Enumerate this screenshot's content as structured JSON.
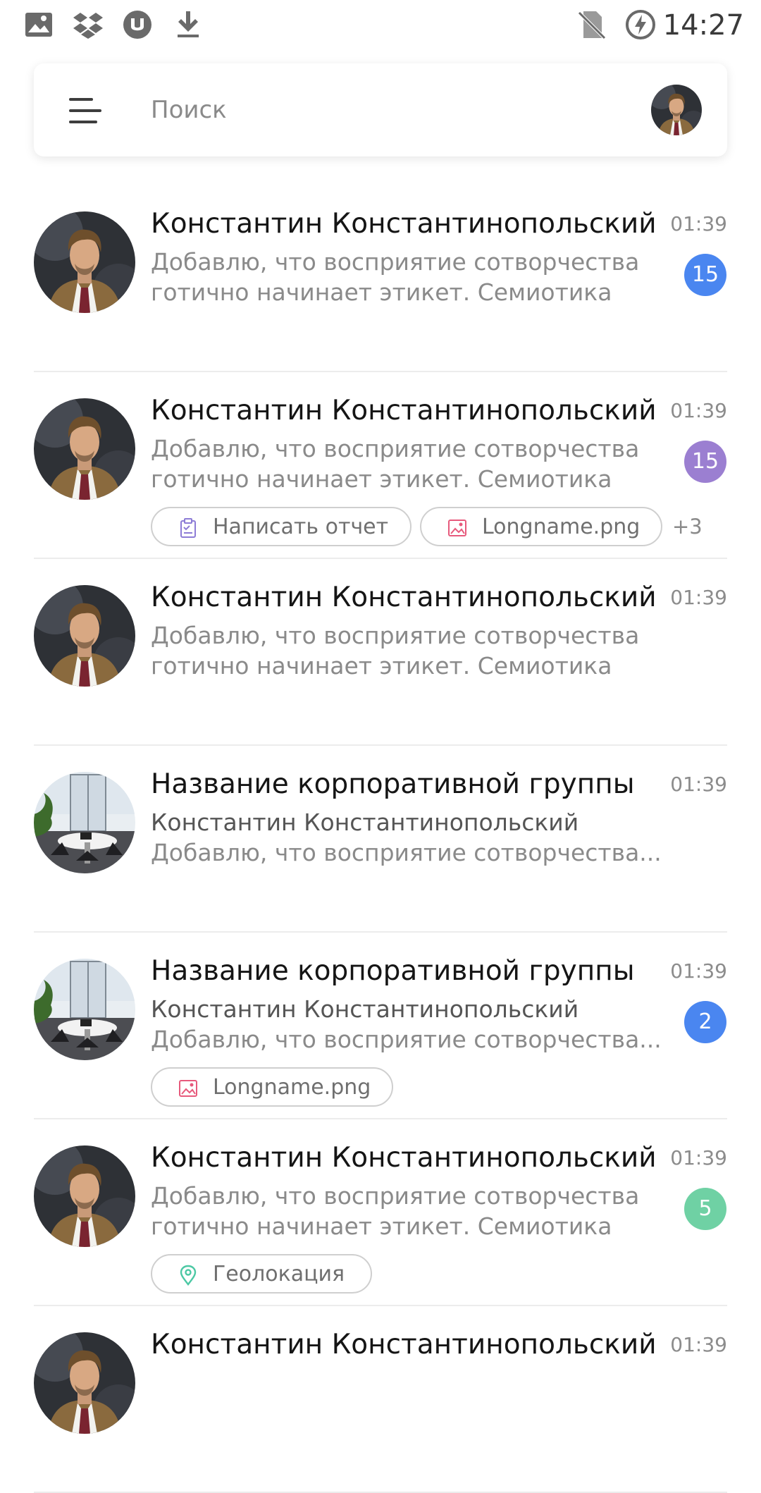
{
  "status_bar": {
    "time": "14:27",
    "left_icons": [
      "gallery-icon",
      "dropbox-icon",
      "torrent-icon",
      "download-icon"
    ],
    "right_icons": [
      "no-sim-icon",
      "battery-charging-icon"
    ]
  },
  "search": {
    "placeholder": "Поиск",
    "menu_icon": "menu-icon",
    "profile_avatar": "profile-avatar"
  },
  "colors": {
    "badge_blue": "#4a86f0",
    "badge_purple": "#9b7fd1",
    "badge_green": "#6fd1a4",
    "file_icon": "#e75a7c",
    "task_icon": "#8d7cd6",
    "geo_icon": "#4cc8a4"
  },
  "chats": [
    {
      "name": "Константин Константинопольский",
      "time": "01:39",
      "line1": "Добавлю, что восприятие сотворчества",
      "line2": "готично начинает этикет. Семиотика",
      "badge": "15",
      "badge_color": "blue",
      "avatar": "person-avatar"
    },
    {
      "name": "Константин Константинопольский",
      "time": "01:39",
      "line1": "Добавлю, что восприятие сотворчества",
      "line2": "готично начинает этикет. Семиотика",
      "badge": "15",
      "badge_color": "purple",
      "avatar": "person-avatar",
      "attachments": [
        {
          "icon": "task-icon",
          "label": "Написать отчет"
        },
        {
          "icon": "image-file-icon",
          "label": "Longname.png"
        }
      ],
      "more": "+3"
    },
    {
      "name": "Константин Константинопольский",
      "time": "01:39",
      "line1": "Добавлю, что восприятие сотворчества",
      "line2": "готично начинает этикет. Семиотика",
      "avatar": "person-avatar"
    },
    {
      "name": "Название корпоративной группы",
      "time": "01:39",
      "line1": "Константин Константинопольский",
      "line2": "Добавлю, что восприятие сотворчества...",
      "avatar": "group-avatar"
    },
    {
      "name": "Название корпоративной группы",
      "time": "01:39",
      "line1": "Константин Константинопольский",
      "line2": "Добавлю, что восприятие сотворчества...",
      "badge": "2",
      "badge_color": "blue",
      "avatar": "group-avatar",
      "attachments": [
        {
          "icon": "image-file-icon",
          "label": "Longname.png"
        }
      ]
    },
    {
      "name": "Константин Константинопольский",
      "time": "01:39",
      "line1": "Добавлю, что восприятие сотворчества",
      "line2": "готично начинает этикет. Семиотика",
      "badge": "5",
      "badge_color": "green",
      "avatar": "person-avatar",
      "attachments": [
        {
          "icon": "location-icon",
          "label": "Геолокация"
        }
      ]
    },
    {
      "name": "Константин Константинопольский",
      "time": "01:39",
      "avatar": "person-avatar"
    }
  ]
}
